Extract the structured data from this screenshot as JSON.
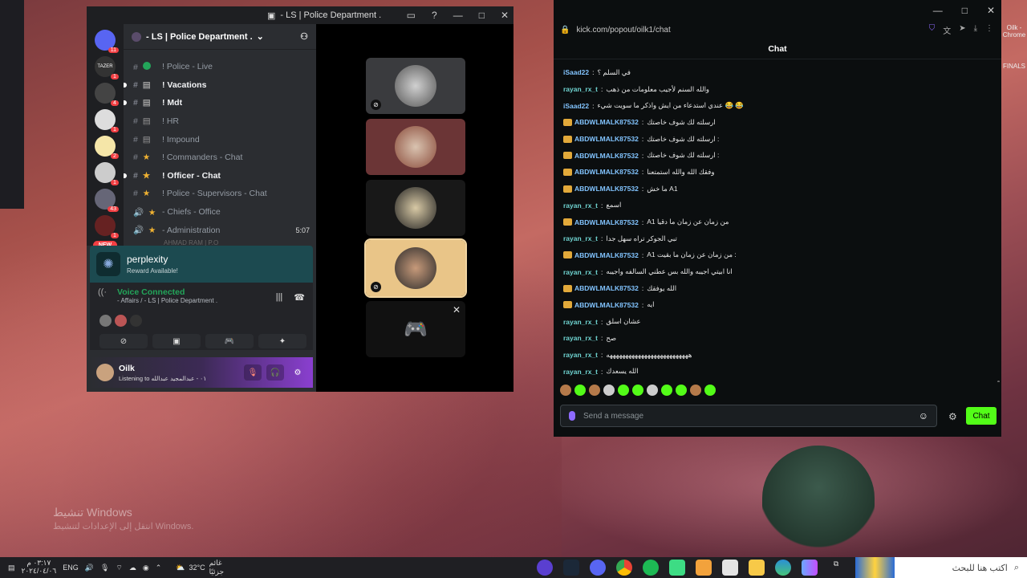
{
  "discord": {
    "window_title": "- LS | Police Department .",
    "server_name": "- LS | Police Department .",
    "guild_badges": [
      "11",
      "1",
      "4",
      "1",
      "2",
      "1",
      "43",
      "1"
    ],
    "guild_labels": {
      "tazer": "TAZER"
    },
    "new_label": "NEW",
    "channels": [
      {
        "prefix": "#",
        "label": "! Police - Live",
        "bold": false,
        "dot": true
      },
      {
        "prefix": "#",
        "label": "! Vacations",
        "bold": true
      },
      {
        "prefix": "#",
        "label": "! Mdt",
        "bold": true
      },
      {
        "prefix": "#",
        "label": "! HR",
        "bold": false
      },
      {
        "prefix": "#",
        "label": "! Impound",
        "bold": false
      },
      {
        "prefix": "#",
        "label": "! Commanders - Chat",
        "bold": false,
        "star": true
      },
      {
        "prefix": "#",
        "label": "! Officer - Chat",
        "bold": true,
        "star": true
      },
      {
        "prefix": "#",
        "label": "! Police - Supervisors - Chat",
        "bold": false,
        "star": true
      },
      {
        "prefix": "🔊",
        "label": "- Chiefs - Office",
        "bold": false,
        "star": true
      },
      {
        "prefix": "🔊",
        "label": "- Administration",
        "bold": false,
        "star": true,
        "right": "5:07"
      }
    ],
    "peek_user": "AHMAD RAM | P.O",
    "perplexity": {
      "name": "perplexity",
      "sub": "Reward Available!"
    },
    "voice": {
      "status": "Voice Connected",
      "channel": "- Affairs / - LS | Police Department ."
    },
    "user": {
      "name": "Oilk",
      "status": "Listening to ٠١ - عبدالمجيد عبدالله"
    }
  },
  "kick": {
    "url": "kick.com/popout/oilk1/chat",
    "header": "Chat",
    "messages": [
      {
        "user": "iSaad22",
        "color": "blue",
        "crown": false,
        "text": "في السلم ؟"
      },
      {
        "user": "rayan_rx_t",
        "color": "teal",
        "crown": false,
        "text": "والله السنم لأجيب معلومات من ذهب"
      },
      {
        "user": "iSaad22",
        "color": "blue",
        "crown": false,
        "text": "عندي استدعاء من ايش واذكر ما سويت شيء 😂 😂"
      },
      {
        "user": "ABDWLMALK87532",
        "color": "blue",
        "crown": true,
        "text": "ارسلته لك شوف خاصتك"
      },
      {
        "user": "ABDWLMALK87532",
        "color": "blue",
        "crown": true,
        "text": "ارسلته لك شوف خاصتك :"
      },
      {
        "user": "ABDWLMALK87532",
        "color": "blue",
        "crown": true,
        "text": "ارسلته لك شوف خاصتك :"
      },
      {
        "user": "ABDWLMALK87532",
        "color": "blue",
        "crown": true,
        "text": "وفقك الله والله استمتعنا"
      },
      {
        "user": "ABDWLMALK87532",
        "color": "blue",
        "crown": true,
        "text": "ما خش A1"
      },
      {
        "user": "rayan_rx_t",
        "color": "teal",
        "crown": false,
        "text": "اسمع"
      },
      {
        "user": "ABDWLMALK87532",
        "color": "blue",
        "crown": true,
        "text": "A1 من زمان عن زمان ما دقيا"
      },
      {
        "user": "rayan_rx_t",
        "color": "teal",
        "crown": false,
        "text": "تبي الجوكر تراه سهل جدا"
      },
      {
        "user": "ABDWLMALK87532",
        "color": "blue",
        "crown": true,
        "text": "A1 من زمان عن زمان ما بقيت :"
      },
      {
        "user": "rayan_rx_t",
        "color": "teal",
        "crown": false,
        "text": "انا ابيتي اجيبه والله بس عطني السالفه واجيبه"
      },
      {
        "user": "ABDWLMALK87532",
        "color": "blue",
        "crown": true,
        "text": "الله يوفقك"
      },
      {
        "user": "ABDWLMALK87532",
        "color": "blue",
        "crown": true,
        "text": "ايه"
      },
      {
        "user": "rayan_rx_t",
        "color": "teal",
        "crown": false,
        "text": "عشان اسلق"
      },
      {
        "user": "rayan_rx_t",
        "color": "teal",
        "crown": false,
        "text": "صح"
      },
      {
        "user": "rayan_rx_t",
        "color": "teal",
        "crown": false,
        "text": "ههههههههههههههههههههههههههه"
      },
      {
        "user": "rayan_rx_t",
        "color": "teal",
        "crown": false,
        "text": "الله يسعدك"
      }
    ],
    "input_placeholder": "Send a message",
    "send_label": "Chat"
  },
  "desktop": {
    "activate_title": "تنشيط Windows",
    "activate_sub": "انتقل إلى الإعدادات لتنشيط Windows.",
    "right_icon_label": "FINALS",
    "right_chrome_label": "Oilk - Chrome"
  },
  "taskbar": {
    "time": "٠٣:١٧ م",
    "date": "٢٠٢٤/٠٤/٠٦",
    "lang": "ENG",
    "temp": "32°C",
    "weather": "غائم جزئيًا",
    "search_placeholder": "اكتب هنا للبحث"
  }
}
